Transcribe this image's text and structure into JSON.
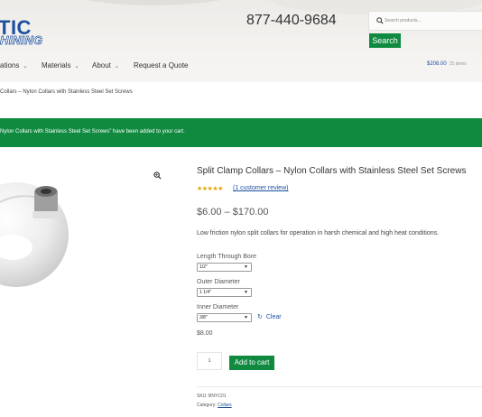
{
  "header": {
    "logo_line1": "TIC",
    "logo_line2": "HINING",
    "phone": "877-440-9684",
    "search": {
      "placeholder": "Search products...",
      "button_label": "Search"
    },
    "cart": {
      "total": "$208.00",
      "items": "25 items"
    }
  },
  "nav": {
    "items": [
      {
        "label": "ations",
        "has_dropdown": true
      },
      {
        "label": "Materials",
        "has_dropdown": true
      },
      {
        "label": "About",
        "has_dropdown": true
      },
      {
        "label": "Request a Quote",
        "has_dropdown": false
      }
    ]
  },
  "breadcrumb": "Collars – Nylon Collars with Stainless Steel Set Screws",
  "notice": "Nylon Collars with Stainless Steel Set Screws” have been added to your cart.",
  "product": {
    "title": "Split Clamp Collars – Nylon Collars with Stainless Steel Set Screws",
    "stars": "★★★★★",
    "rating": 5,
    "review_link": "(1 customer review)",
    "price_range": "$6.00 – $170.00",
    "description": "Low friction nylon split collars for operation in harsh chemical and high heat conditions.",
    "options": [
      {
        "label": "Length Through Bore",
        "value": "1/2\""
      },
      {
        "label": "Outer Diameter",
        "value": "1 1/4\""
      },
      {
        "label": "Inner Diameter",
        "value": "3/8\""
      }
    ],
    "clear_label": "Clear",
    "variant_price": "$8.00",
    "quantity": "1",
    "add_to_cart_label": "Add to cart",
    "sku": "SKU: BNYC01",
    "category_prefix": "Category:",
    "category": "Collars"
  },
  "colors": {
    "accent_green": "#0f8a3f",
    "link_blue": "#1d4f9e",
    "star_gold": "#e6a100"
  },
  "icons": {
    "search": "search-icon",
    "zoom": "zoom-icon",
    "clear": "refresh-icon",
    "dropdown": "chevron-down-icon"
  }
}
